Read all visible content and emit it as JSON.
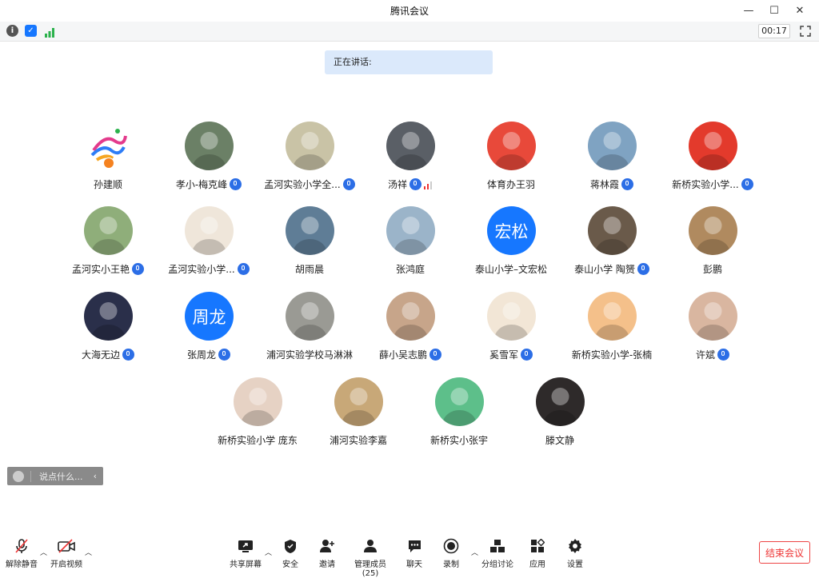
{
  "window": {
    "title": "腾讯会议"
  },
  "toolbar": {
    "timer": "00:17"
  },
  "speaking": {
    "label": "正在讲话:"
  },
  "participants": [
    {
      "name": "孙建顺",
      "mic": false,
      "avatar": "logo",
      "bg": "#ffffff"
    },
    {
      "name": "孝小-梅克峰",
      "mic": true,
      "avatar": "photo",
      "bg": "#6b8066"
    },
    {
      "name": "孟河实验小学全...",
      "mic": true,
      "avatar": "photo",
      "bg": "#c9c3a6"
    },
    {
      "name": "汤祥",
      "mic": true,
      "avatar": "photo",
      "bg": "#5a5f66"
    },
    {
      "name": "体育办王羽",
      "mic": false,
      "avatar": "photo",
      "bg": "#e8493a"
    },
    {
      "name": "蒋林霞",
      "mic": true,
      "avatar": "photo",
      "bg": "#7fa3c2"
    },
    {
      "name": "新桥实验小学...",
      "mic": true,
      "avatar": "photo",
      "bg": "#e33a2c"
    },
    {
      "name": "孟河实小王艳",
      "mic": true,
      "avatar": "photo",
      "bg": "#8fae7a"
    },
    {
      "name": "孟河实验小学...",
      "mic": true,
      "avatar": "photo",
      "bg": "#efe6da"
    },
    {
      "name": "胡雨晨",
      "mic": false,
      "avatar": "photo",
      "bg": "#5f7d96"
    },
    {
      "name": "张鸿庭",
      "mic": false,
      "avatar": "photo",
      "bg": "#9bb4c9"
    },
    {
      "name": "泰山小学–文宏松",
      "mic": false,
      "avatar": "text",
      "text": "宏松",
      "bg": "#1677ff"
    },
    {
      "name": "泰山小学 陶赟",
      "mic": true,
      "avatar": "photo",
      "bg": "#6a5a4a"
    },
    {
      "name": "彭鹏",
      "mic": false,
      "avatar": "photo",
      "bg": "#b08a5f"
    },
    {
      "name": "大海无边",
      "mic": true,
      "avatar": "photo",
      "bg": "#2a2f4a"
    },
    {
      "name": "张周龙",
      "mic": true,
      "avatar": "text",
      "text": "周龙",
      "bg": "#1677ff"
    },
    {
      "name": "浦河实验学校马淋淋",
      "mic": false,
      "avatar": "photo",
      "bg": "#9a9a94"
    },
    {
      "name": "薛小吴志鹏",
      "mic": true,
      "avatar": "photo",
      "bg": "#c7a58a"
    },
    {
      "name": "奚雪军",
      "mic": true,
      "avatar": "photo",
      "bg": "#f2e6d6"
    },
    {
      "name": "新桥实验小学-张楠",
      "mic": false,
      "avatar": "photo",
      "bg": "#f4c08a"
    },
    {
      "name": "许斌",
      "mic": true,
      "avatar": "photo",
      "bg": "#d9b6a0"
    },
    {
      "name": "新桥实验小学  庞东",
      "mic": false,
      "avatar": "photo",
      "bg": "#e6d2c4"
    },
    {
      "name": "浦河实验李嘉",
      "mic": false,
      "avatar": "photo",
      "bg": "#c8a878"
    },
    {
      "name": "新桥实小张宇",
      "mic": false,
      "avatar": "photo",
      "bg": "#5dbf8a"
    },
    {
      "name": "滕文静",
      "mic": false,
      "avatar": "photo",
      "bg": "#2e2a2a"
    }
  ],
  "chat": {
    "placeholder": "说点什么..."
  },
  "bottom": {
    "unmute": "解除静音",
    "video": "开启视频",
    "share": "共享屏幕",
    "security": "安全",
    "invite": "邀请",
    "members": "管理成员(25)",
    "chat": "聊天",
    "record": "录制",
    "breakout": "分组讨论",
    "apps": "应用",
    "settings": "设置",
    "end": "结束会议"
  }
}
